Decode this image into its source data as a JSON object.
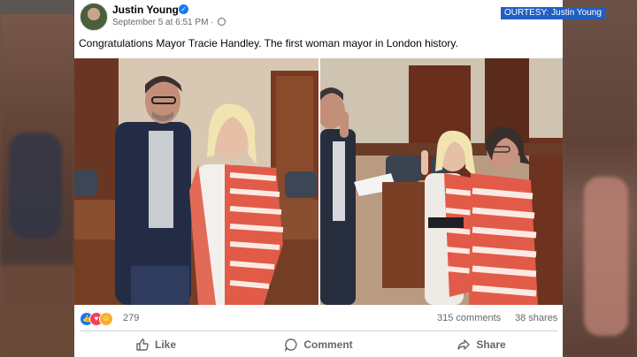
{
  "post": {
    "author": "Justin Young",
    "verified_icon": "verified-badge-icon",
    "date": "September 5 at 6:51 PM",
    "separator": "·",
    "text": "Congratulations Mayor Tracie Handley. The first woman mayor in London history."
  },
  "overlay": {
    "courtesy": "OURTESY: Justin Young"
  },
  "stats": {
    "reaction_count": "279",
    "comments": "315 comments",
    "shares": "38 shares",
    "reaction_icons": [
      "like-reaction-icon",
      "love-reaction-icon",
      "haha-reaction-icon"
    ]
  },
  "actions": {
    "like": "Like",
    "comment": "Comment",
    "share": "Share"
  },
  "colors": {
    "facebook_blue": "#1877f2",
    "text_secondary": "#65676b",
    "courtesy_bg": "#1f5fbf"
  }
}
